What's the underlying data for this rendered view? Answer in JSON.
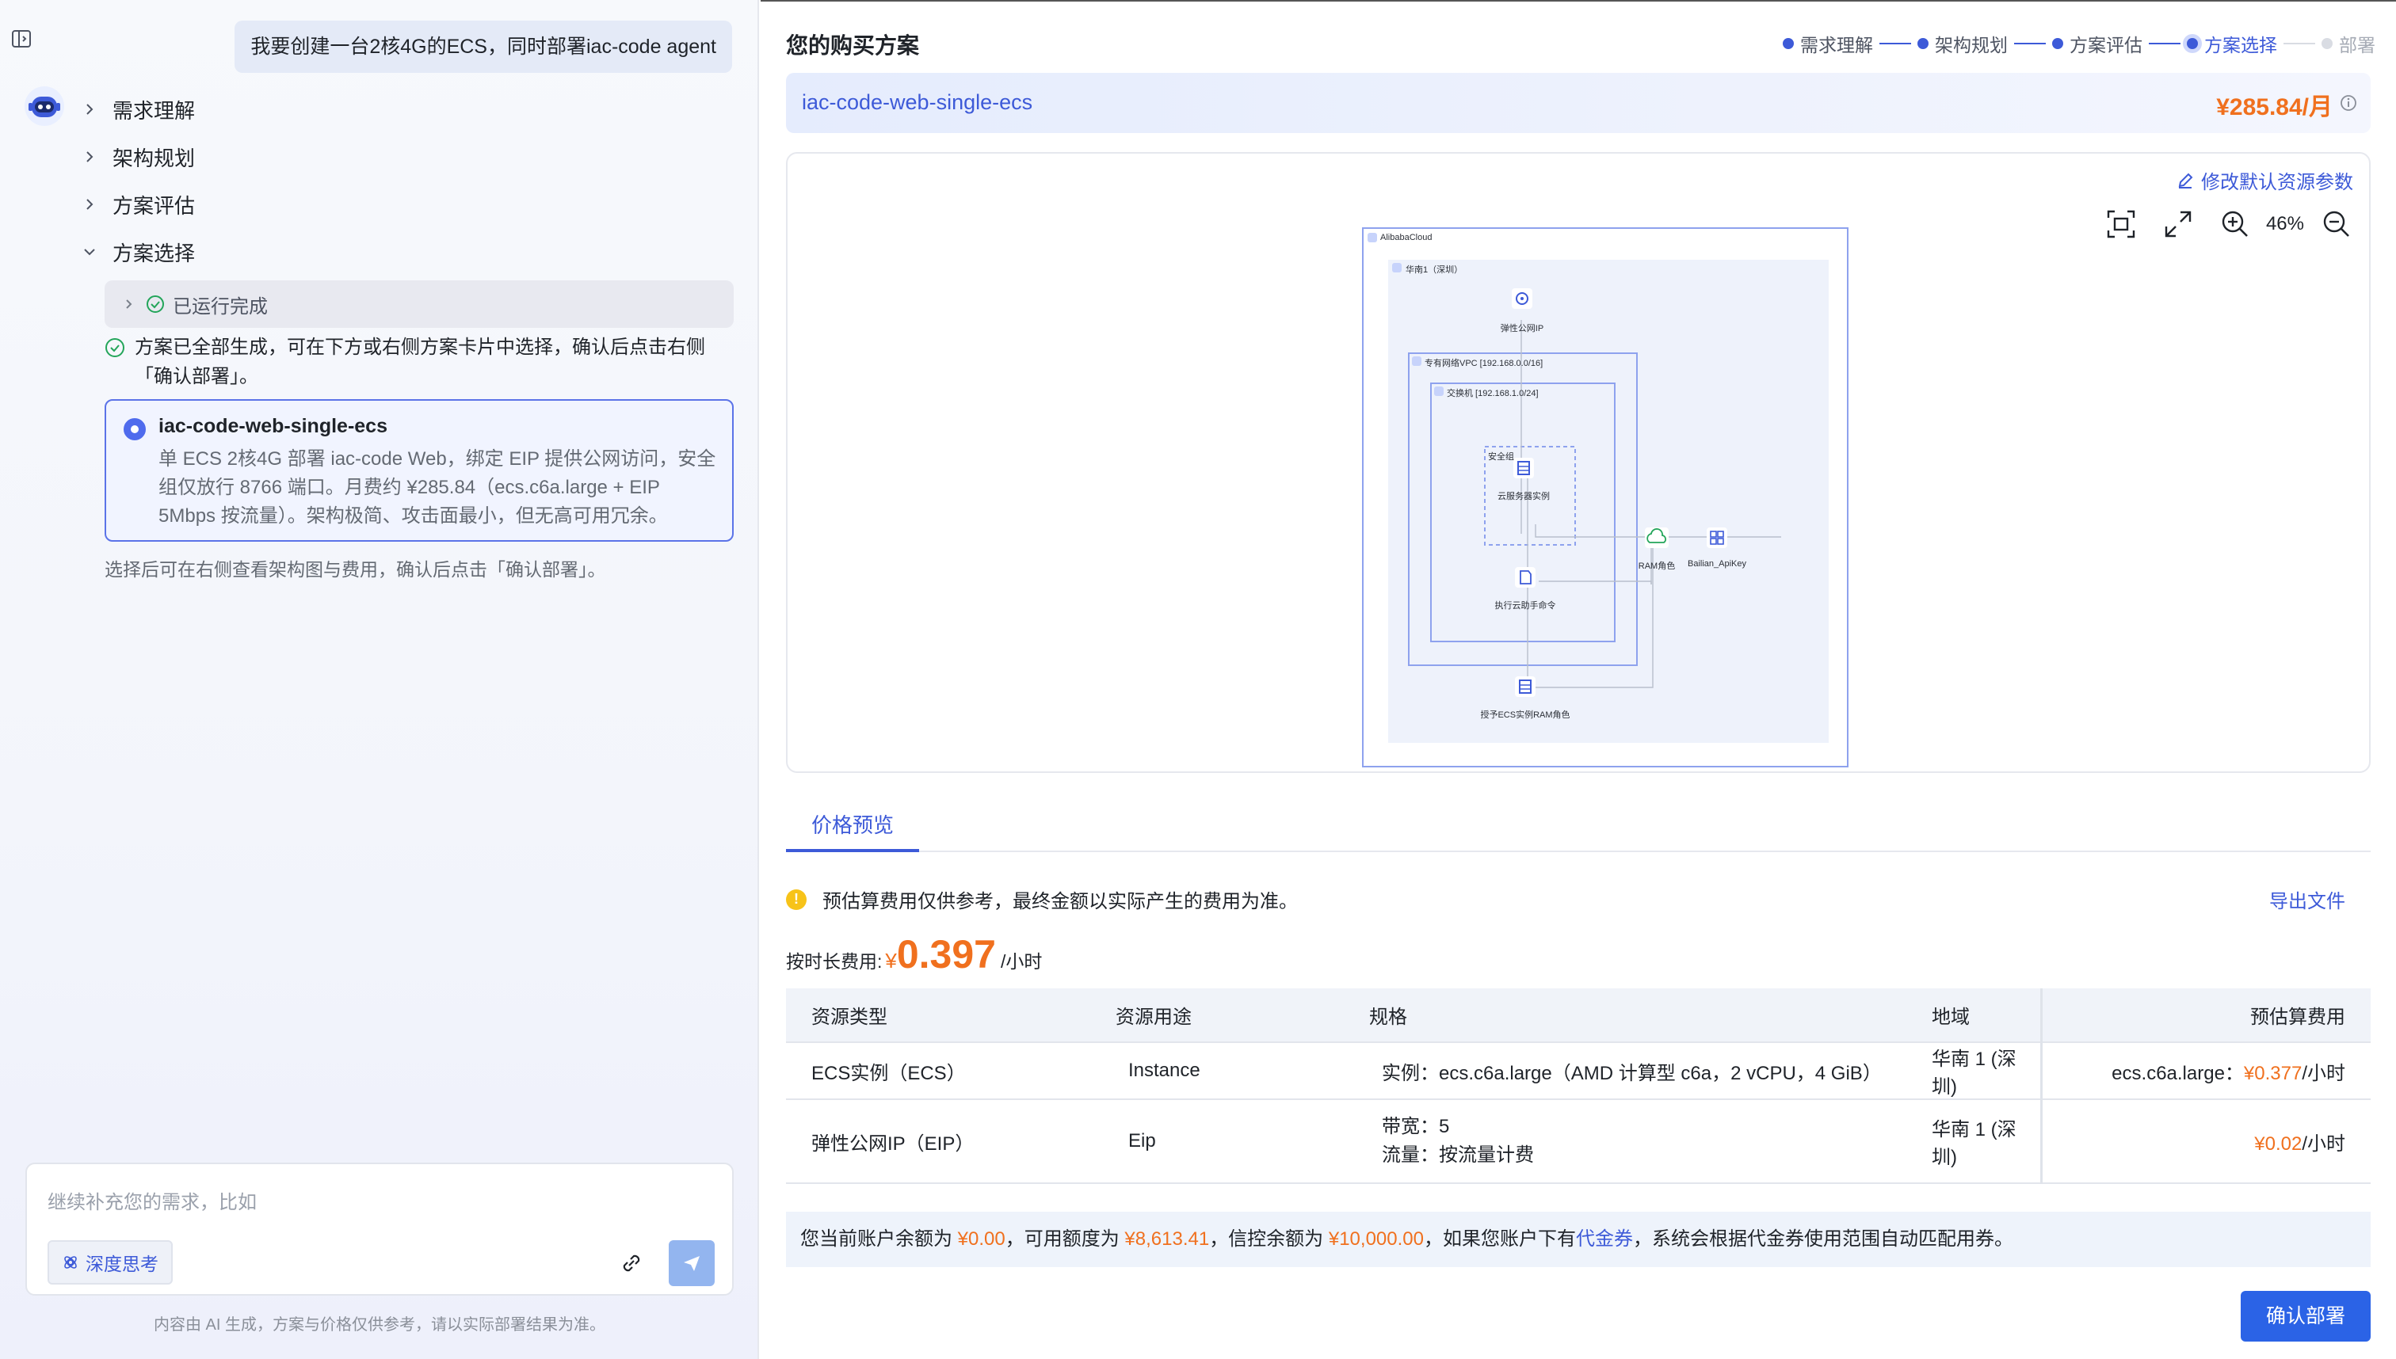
{
  "user_message": "我要创建一台2核4G的ECS，同时部署iac-code agent",
  "steps": [
    {
      "label": "需求理解"
    },
    {
      "label": "架构规划"
    },
    {
      "label": "方案评估"
    },
    {
      "label": "方案选择"
    }
  ],
  "run_status": "已运行完成",
  "status_message": "方案已全部生成，可在下方或右侧方案卡片中选择，确认后点击右侧「确认部署」。",
  "plan_card": {
    "title": "iac-code-web-single-ecs",
    "description": "单 ECS 2核4G 部署 iac-code Web，绑定 EIP 提供公网访问，安全组仅放行 8766 端口。月费约 ¥285.84（ecs.c6a.large + EIP 5Mbps 按流量）。架构极简、攻击面最小，但无高可用冗余。"
  },
  "hint": "选择后可在右侧查看架构图与费用，确认后点击「确认部署」。",
  "input": {
    "placeholder": "继续补充您的需求，比如",
    "deep_think_label": "深度思考"
  },
  "disclaimer": "内容由 AI 生成，方案与价格仅供参考，请以实际部署结果为准。",
  "right": {
    "title": "您的购买方案",
    "stepper": [
      "需求理解",
      "架构规划",
      "方案评估",
      "方案选择",
      "部署"
    ],
    "plan_name": "iac-code-web-single-ecs",
    "monthly_price": "¥285.84/月",
    "modify_link": "修改默认资源参数",
    "zoom": "46%"
  },
  "diagram": {
    "cloud": "AlibabaCloud",
    "region": "华南1（深圳）",
    "eip": "弹性公网IP",
    "vpc": "专有网络VPC [192.168.0.0/16]",
    "vswitch": "交换机 [192.168.1.0/24]",
    "security_group": "安全组",
    "ecs": "云服务器实例",
    "command": "执行云助手命令",
    "ram_role": "RAM角色",
    "apikey": "Bailian_ApiKey",
    "ram_attach": "授予ECS实例RAM角色"
  },
  "pricing": {
    "tab": "价格预览",
    "notice": "预估算费用仅供参考，最终金额以实际产生的费用为准。",
    "export": "导出文件",
    "hourly_label": "按时长费用:",
    "hourly_currency": "¥",
    "hourly_value": "0.397",
    "hourly_unit": "/小时",
    "headers": [
      "资源类型",
      "资源用途",
      "规格",
      "地域",
      "预估算费用"
    ],
    "rows": [
      {
        "type": "ECS实例（ECS）",
        "usage": "Instance",
        "spec": "实例：ecs.c6a.large（AMD 计算型 c6a，2 vCPU，4 GiB）",
        "region": "华南 1 (深圳)",
        "fee_prefix": "ecs.c6a.large：",
        "fee_value": "¥0.377",
        "fee_unit": "/小时"
      },
      {
        "type": "弹性公网IP（EIP）",
        "usage": "Eip",
        "spec_line1": "带宽：5",
        "spec_line2": "流量：按流量计费",
        "region": "华南 1 (深圳)",
        "fee_value": "¥0.02",
        "fee_unit": "/小时"
      }
    ]
  },
  "balance": {
    "p1": "您当前账户余额为 ",
    "balance": "¥0.00",
    "p2": "，可用额度为 ",
    "credit": "¥8,613.41",
    "p3": "，信控余额为 ",
    "trust": "¥10,000.00",
    "p4": "，如果您账户下有",
    "voucher": "代金券",
    "p5": "，系统会根据代金券使用范围自动匹配用券。"
  },
  "confirm_label": "确认部署",
  "colors": {
    "accent": "#3d5ad8",
    "price": "#f0701e",
    "primary_button": "#2b63e6",
    "success": "#23a55a"
  },
  "icons": [
    "sidebar-toggle-icon",
    "robot-avatar-icon",
    "chevron-right-icon",
    "chevron-down-icon",
    "check-circle-icon",
    "info-icon",
    "edit-icon",
    "fit-view-icon",
    "fullscreen-icon",
    "zoom-in-icon",
    "zoom-out-icon",
    "warning-icon",
    "link-icon",
    "send-icon"
  ]
}
